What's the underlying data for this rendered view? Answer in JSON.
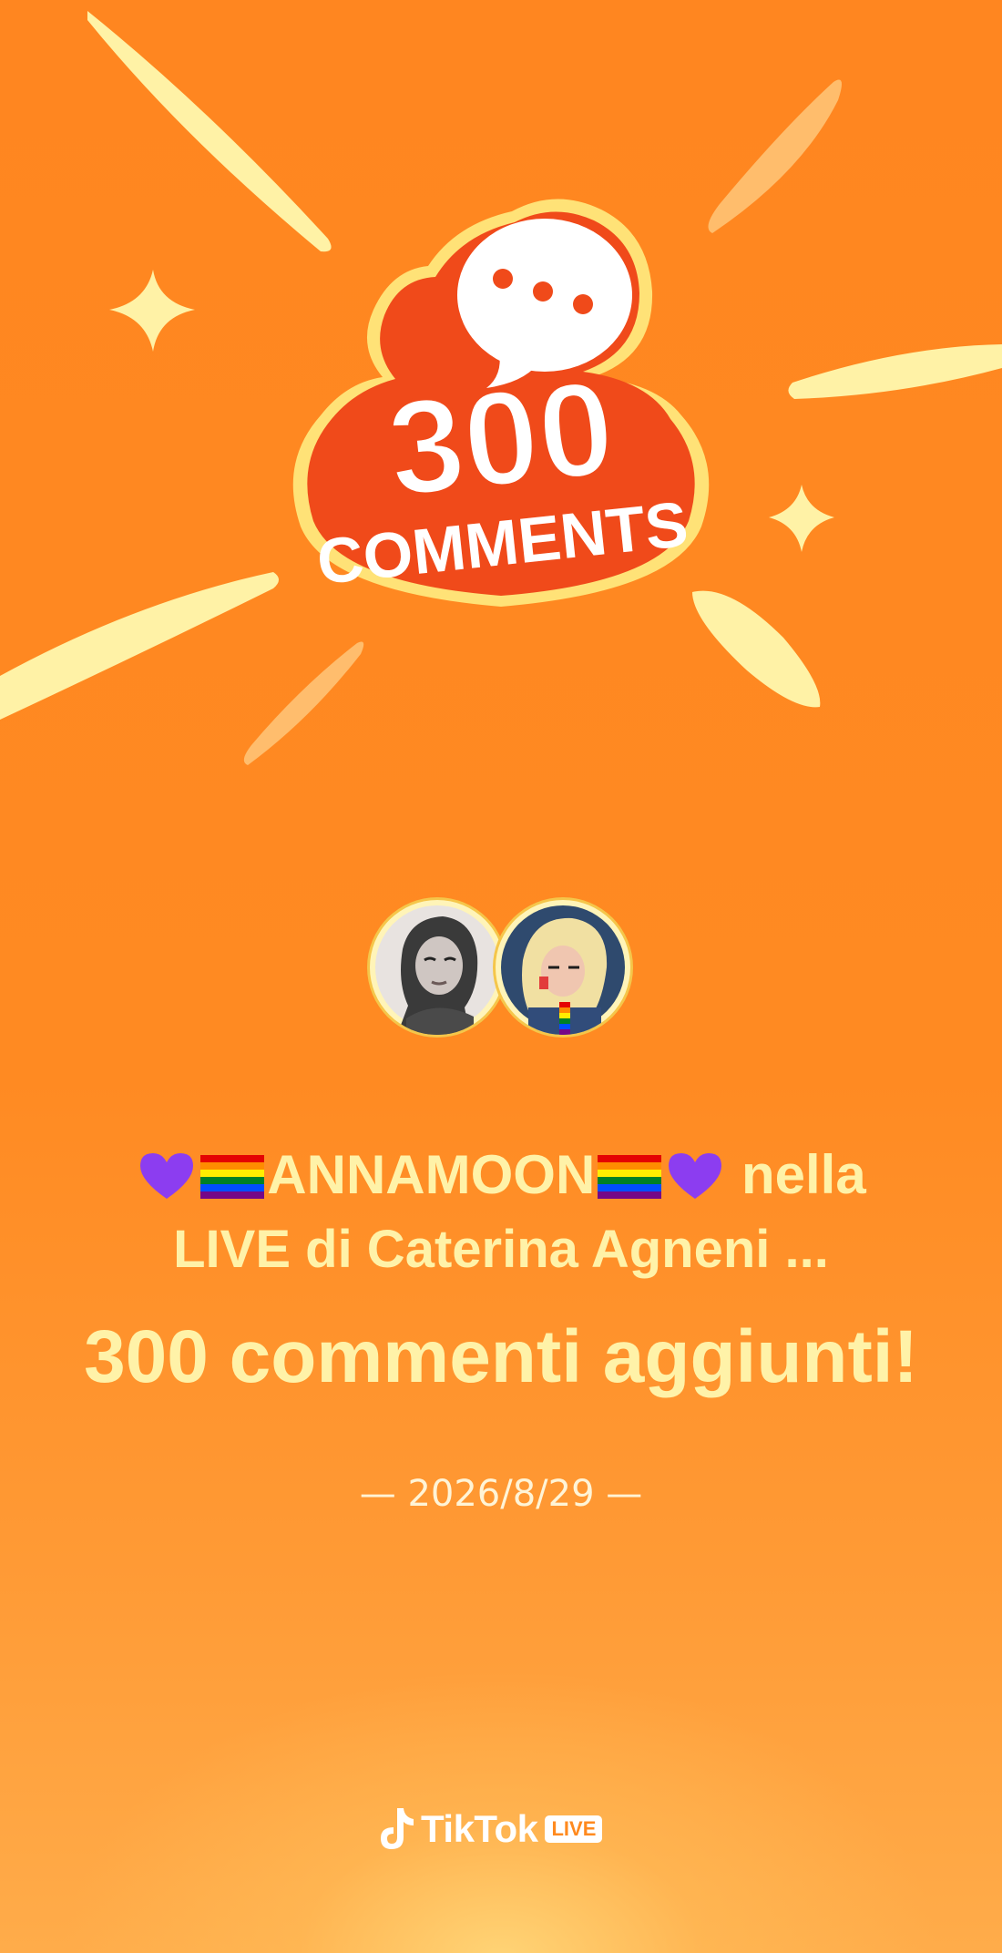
{
  "badge": {
    "number": "300",
    "word": "COMMENTS",
    "icon": "speech-bubble-icon"
  },
  "message": {
    "user_name": "ANNAMOON",
    "user_emojis": [
      "purple-heart-icon",
      "rainbow-flag-icon",
      "rainbow-flag-icon",
      "purple-heart-icon"
    ],
    "connector": "nella",
    "live_line": "LIVE di Caterina Agneni ...",
    "headline": "300 commenti aggiunti!",
    "date": "— 2026/8/29 —"
  },
  "avatars": [
    {
      "name": "avatar-user",
      "style": "grayscale portrait"
    },
    {
      "name": "avatar-host",
      "style": "color portrait with rainbow flag"
    }
  ],
  "brand": {
    "name": "TikTok",
    "badge": "LIVE",
    "icon": "tiktok-note-icon"
  },
  "colors": {
    "background": "#ff8a1f",
    "text_gold": "#fff2a8",
    "badge_red": "#f04a1a",
    "badge_outline": "#ffe277",
    "rays": "#fff1a6"
  }
}
